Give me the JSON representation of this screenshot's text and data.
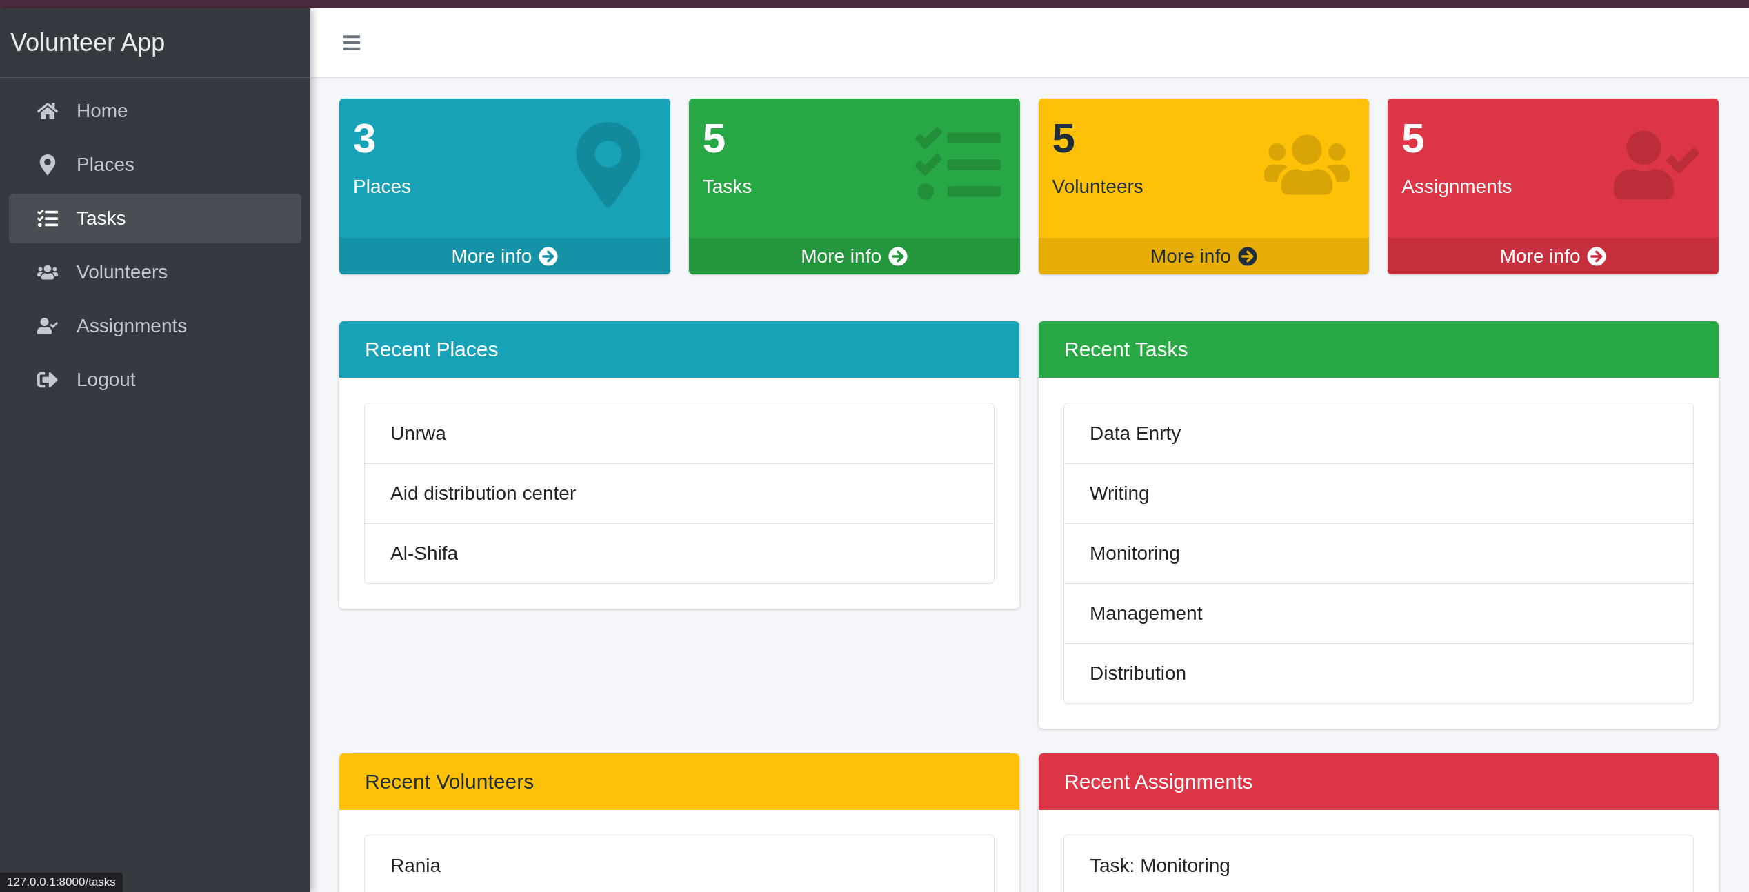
{
  "sidebar": {
    "brand": "Volunteer App",
    "items": [
      {
        "label": "Home",
        "kind": "home",
        "selected": false
      },
      {
        "label": "Places",
        "kind": "place",
        "selected": false
      },
      {
        "label": "Tasks",
        "kind": "tasks",
        "selected": true
      },
      {
        "label": "Volunteers",
        "kind": "people",
        "selected": false
      },
      {
        "label": "Assignments",
        "kind": "assign",
        "selected": false
      },
      {
        "label": "Logout",
        "kind": "logout",
        "selected": false
      }
    ]
  },
  "stat_boxes": [
    {
      "count": "3",
      "label": "Places",
      "link": "More info",
      "kind": "info"
    },
    {
      "count": "5",
      "label": "Tasks",
      "link": "More info",
      "kind": "success"
    },
    {
      "count": "5",
      "label": "Volunteers",
      "link": "More info",
      "kind": "warning"
    },
    {
      "count": "5",
      "label": "Assignments",
      "link": "More info",
      "kind": "danger"
    }
  ],
  "cards": [
    {
      "title": "Recent Places",
      "kind": "info",
      "items": [
        "Unrwa",
        "Aid distribution center",
        "Al-Shifa"
      ]
    },
    {
      "title": "Recent Tasks",
      "kind": "success",
      "items": [
        "Data Enrty",
        "Writing",
        "Monitoring",
        "Management",
        "Distribution"
      ]
    },
    {
      "title": "Recent Volunteers",
      "kind": "warning",
      "items": [
        "Rania"
      ]
    },
    {
      "title": "Recent Assignments",
      "kind": "danger",
      "items": [
        "Task: Monitoring"
      ]
    }
  ],
  "status_url": "127.0.0.1:8000/tasks"
}
